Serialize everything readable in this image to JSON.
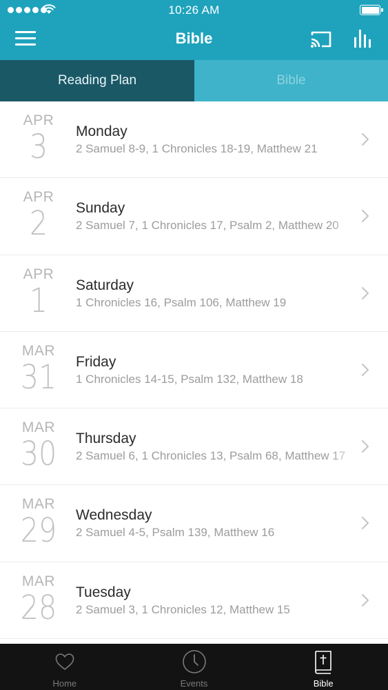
{
  "status": {
    "time": "10:26 AM"
  },
  "nav": {
    "title": "Bible"
  },
  "tabs": [
    {
      "label": "Reading Plan",
      "active": true
    },
    {
      "label": "Bible",
      "active": false
    }
  ],
  "plan": [
    {
      "month": "APR",
      "day": "3",
      "weekday": "Monday",
      "readings": "2 Samuel 8-9, 1 Chronicles 18-19, Matthew 21"
    },
    {
      "month": "APR",
      "day": "2",
      "weekday": "Sunday",
      "readings": "2 Samuel 7, 1 Chronicles 17, Psalm 2, Matthew 20"
    },
    {
      "month": "APR",
      "day": "1",
      "weekday": "Saturday",
      "readings": "1 Chronicles 16, Psalm 106, Matthew 19"
    },
    {
      "month": "MAR",
      "day": "31",
      "weekday": "Friday",
      "readings": "1 Chronicles 14-15, Psalm 132, Matthew 18"
    },
    {
      "month": "MAR",
      "day": "30",
      "weekday": "Thursday",
      "readings": "2 Samuel 6, 1 Chronicles 13, Psalm 68, Matthew 17"
    },
    {
      "month": "MAR",
      "day": "29",
      "weekday": "Wednesday",
      "readings": "2 Samuel 4-5, Psalm 139, Matthew 16"
    },
    {
      "month": "MAR",
      "day": "28",
      "weekday": "Tuesday",
      "readings": "2 Samuel 3, 1 Chronicles 12, Matthew 15"
    }
  ],
  "tabbar": [
    {
      "label": "Home",
      "icon": "heart-icon",
      "active": false
    },
    {
      "label": "Events",
      "icon": "clock-icon",
      "active": false
    },
    {
      "label": "Bible",
      "icon": "bible-icon",
      "active": true
    }
  ],
  "colors": {
    "nav": "#1fa3bd",
    "tab_active": "#1a5866",
    "tab_inactive": "#3eb3c9",
    "tabbar": "#131313"
  }
}
